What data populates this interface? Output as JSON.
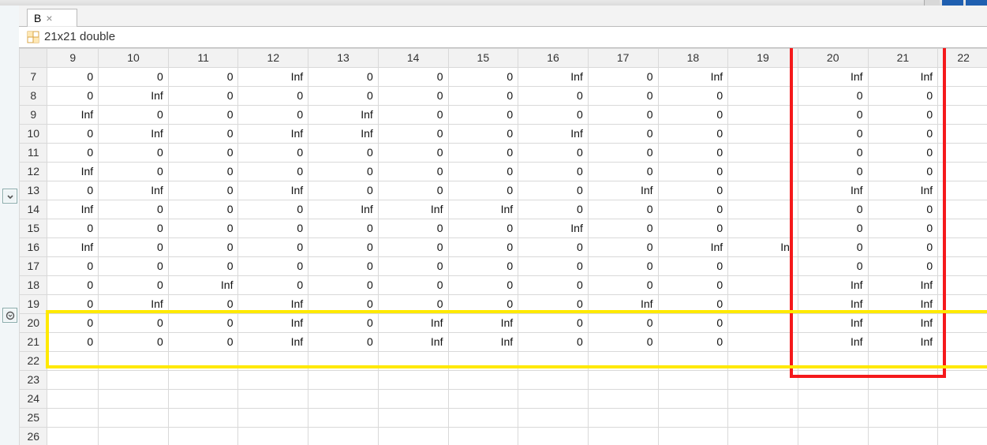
{
  "tab": {
    "label": "B",
    "close": "×"
  },
  "variable": {
    "description": "21x21 double"
  },
  "columns": [
    "9",
    "10",
    "11",
    "12",
    "13",
    "14",
    "15",
    "16",
    "17",
    "18",
    "19",
    "20",
    "21",
    "22"
  ],
  "rowHeaders": [
    "7",
    "8",
    "9",
    "10",
    "11",
    "12",
    "13",
    "14",
    "15",
    "16",
    "17",
    "18",
    "19",
    "20",
    "21",
    "22",
    "23",
    "24",
    "25",
    "26"
  ],
  "cells": [
    [
      "0",
      "0",
      "0",
      "Inf",
      "0",
      "0",
      "0",
      "Inf",
      "0",
      "Inf",
      "",
      "Inf",
      "Inf",
      ""
    ],
    [
      "0",
      "Inf",
      "0",
      "0",
      "0",
      "0",
      "0",
      "0",
      "0",
      "0",
      "",
      "0",
      "0",
      ""
    ],
    [
      "Inf",
      "0",
      "0",
      "0",
      "Inf",
      "0",
      "0",
      "0",
      "0",
      "0",
      "",
      "0",
      "0",
      ""
    ],
    [
      "0",
      "Inf",
      "0",
      "Inf",
      "Inf",
      "0",
      "0",
      "Inf",
      "0",
      "0",
      "",
      "0",
      "0",
      ""
    ],
    [
      "0",
      "0",
      "0",
      "0",
      "0",
      "0",
      "0",
      "0",
      "0",
      "0",
      "",
      "0",
      "0",
      ""
    ],
    [
      "Inf",
      "0",
      "0",
      "0",
      "0",
      "0",
      "0",
      "0",
      "0",
      "0",
      "",
      "0",
      "0",
      ""
    ],
    [
      "0",
      "Inf",
      "0",
      "Inf",
      "0",
      "0",
      "0",
      "0",
      "Inf",
      "0",
      "",
      "Inf",
      "Inf",
      ""
    ],
    [
      "Inf",
      "0",
      "0",
      "0",
      "Inf",
      "Inf",
      "Inf",
      "0",
      "0",
      "0",
      "",
      "0",
      "0",
      ""
    ],
    [
      "0",
      "0",
      "0",
      "0",
      "0",
      "0",
      "0",
      "Inf",
      "0",
      "0",
      "",
      "0",
      "0",
      ""
    ],
    [
      "Inf",
      "0",
      "0",
      "0",
      "0",
      "0",
      "0",
      "0",
      "0",
      "Inf",
      "",
      "0",
      "0",
      ""
    ],
    [
      "0",
      "0",
      "0",
      "0",
      "0",
      "0",
      "0",
      "0",
      "0",
      "0",
      "",
      "0",
      "0",
      ""
    ],
    [
      "0",
      "0",
      "Inf",
      "0",
      "0",
      "0",
      "0",
      "0",
      "0",
      "0",
      "",
      "Inf",
      "Inf",
      ""
    ],
    [
      "0",
      "Inf",
      "0",
      "Inf",
      "0",
      "0",
      "0",
      "0",
      "Inf",
      "0",
      "",
      "Inf",
      "Inf",
      ""
    ],
    [
      "0",
      "0",
      "0",
      "Inf",
      "0",
      "Inf",
      "Inf",
      "0",
      "0",
      "0",
      "",
      "Inf",
      "Inf",
      ""
    ],
    [
      "0",
      "0",
      "0",
      "Inf",
      "0",
      "Inf",
      "Inf",
      "0",
      "0",
      "0",
      "",
      "Inf",
      "Inf",
      ""
    ],
    [
      "",
      "",
      "",
      "",
      "",
      "",
      "",
      "",
      "",
      "",
      "",
      "",
      "",
      ""
    ],
    [
      "",
      "",
      "",
      "",
      "",
      "",
      "",
      "",
      "",
      "",
      "",
      "",
      "",
      ""
    ],
    [
      "",
      "",
      "",
      "",
      "",
      "",
      "",
      "",
      "",
      "",
      "",
      "",
      "",
      ""
    ],
    [
      "",
      "",
      "",
      "",
      "",
      "",
      "",
      "",
      "",
      "",
      "",
      "",
      "",
      ""
    ],
    [
      "",
      "",
      "",
      "",
      "",
      "",
      "",
      "",
      "",
      "",
      "",
      "",
      "",
      ""
    ]
  ],
  "hiddenCol19Val": "Inf"
}
